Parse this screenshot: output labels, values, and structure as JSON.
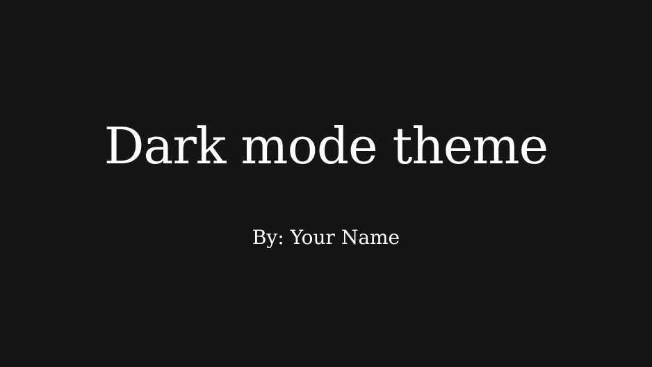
{
  "slide": {
    "title": "Dark mode theme",
    "subtitle": "By: Your Name"
  },
  "colors": {
    "background": "#151515",
    "text": "#ffffff"
  }
}
